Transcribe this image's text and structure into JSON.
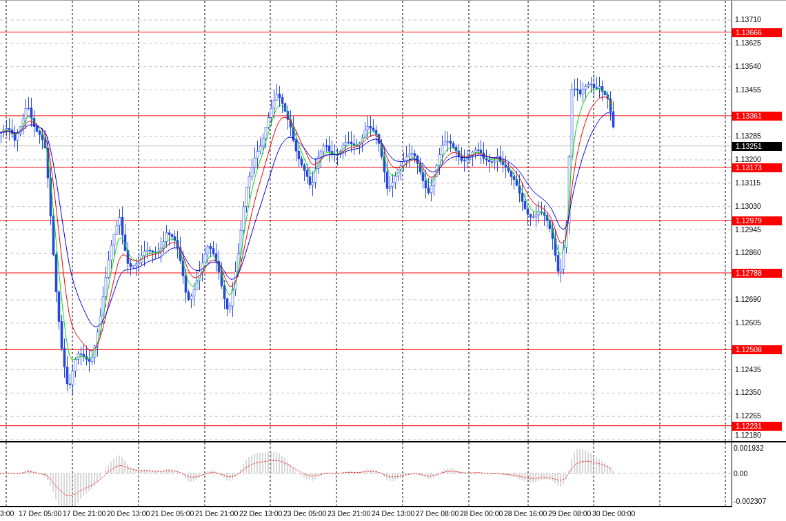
{
  "price_axis": {
    "ticks": [
      "1.13710",
      "1.13625",
      "1.13540",
      "1.13455",
      "1.13285",
      "1.13200",
      "1.13115",
      "1.13030",
      "1.12945",
      "1.12860",
      "1.12690",
      "1.12605",
      "1.12435",
      "1.12350",
      "1.12265",
      "1.12180"
    ]
  },
  "levels": [
    {
      "label": "1.13666"
    },
    {
      "label": "1.13361"
    },
    {
      "label": "1.13173"
    },
    {
      "label": "1.12979"
    },
    {
      "label": "1.12788"
    },
    {
      "label": "1.12508"
    },
    {
      "label": "1.12231"
    }
  ],
  "current_price": {
    "label": "1.13251"
  },
  "indicator_axis": {
    "ticks": [
      "0.001932",
      "0.00",
      "-0.002307"
    ]
  },
  "time_axis": {
    "labels": [
      "3:00",
      "17 Dec 05:00",
      "17 Dec 21:00",
      "20 Dec 13:00",
      "21 Dec 05:00",
      "21 Dec 21:00",
      "22 Dec 13:00",
      "23 Dec 05:00",
      "23 Dec 21:00",
      "24 Dec 13:00",
      "27 Dec 08:00",
      "28 Dec 00:00",
      "28 Dec 16:00",
      "29 Dec 08:00",
      "30 Dec 00:00"
    ]
  }
}
